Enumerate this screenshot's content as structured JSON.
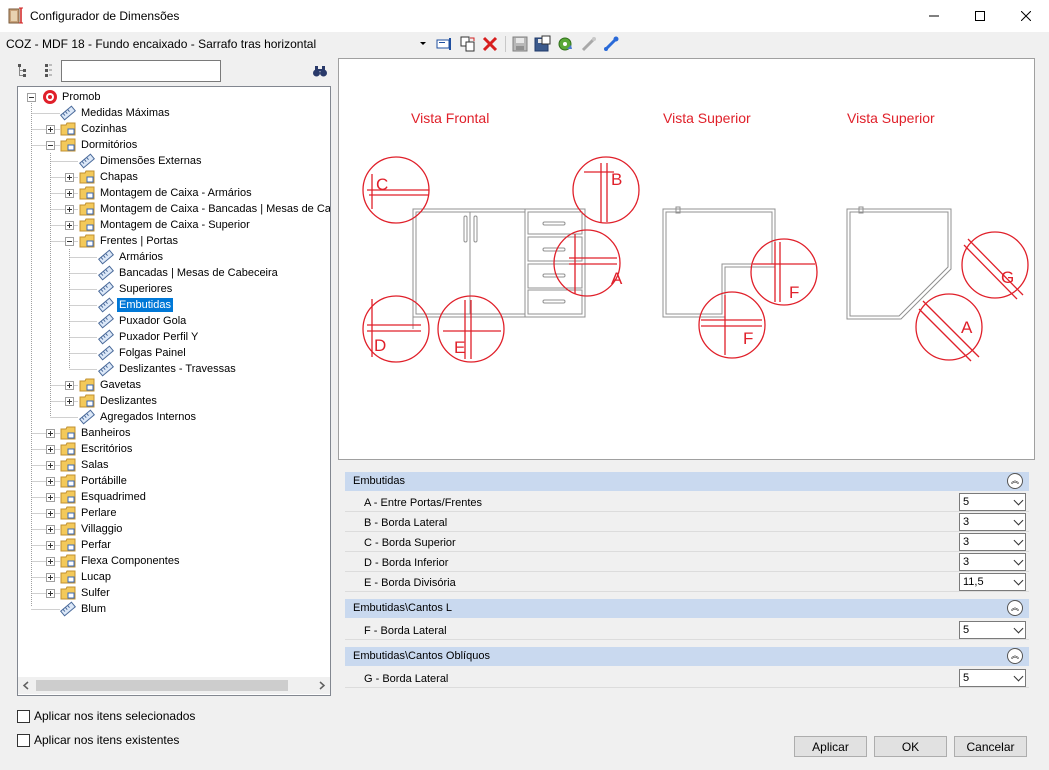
{
  "window": {
    "title": "Configurador de Dimensões",
    "minimize_label": "─",
    "maximize_label": "☐",
    "close_label": "✕"
  },
  "toolbar": {
    "config_value": "COZ - MDF 18 - Fundo encaixado - Sarrafo tras horizontal",
    "icons": [
      "form-icon",
      "copy-icon",
      "delete-icon",
      "save-icon",
      "save-as-icon",
      "settings-icon",
      "link-icon",
      "link-blue-icon"
    ]
  },
  "tree": {
    "items": [
      {
        "label": "Promob"
      },
      {
        "label": "Medidas Máximas"
      },
      {
        "label": "Cozinhas"
      },
      {
        "label": "Dormitórios"
      },
      {
        "label": "Dimensões Externas"
      },
      {
        "label": "Chapas"
      },
      {
        "label": "Montagem de Caixa - Armários"
      },
      {
        "label": "Montagem de Caixa - Bancadas | Mesas de Cabeceira"
      },
      {
        "label": "Montagem de Caixa - Superior"
      },
      {
        "label": "Frentes | Portas"
      },
      {
        "label": "Armários"
      },
      {
        "label": "Bancadas | Mesas de Cabeceira"
      },
      {
        "label": "Superiores"
      },
      {
        "label": "Embutidas"
      },
      {
        "label": "Puxador Gola"
      },
      {
        "label": "Puxador Perfil Y"
      },
      {
        "label": "Folgas Painel"
      },
      {
        "label": "Deslizantes - Travessas"
      },
      {
        "label": "Gavetas"
      },
      {
        "label": "Deslizantes"
      },
      {
        "label": "Agregados Internos"
      },
      {
        "label": "Banheiros"
      },
      {
        "label": "Escritórios"
      },
      {
        "label": "Salas"
      },
      {
        "label": "Portábille"
      },
      {
        "label": "Esquadrimed"
      },
      {
        "label": "Perlare"
      },
      {
        "label": "Villaggio"
      },
      {
        "label": "Perfar"
      },
      {
        "label": "Flexa Componentes"
      },
      {
        "label": "Lucap"
      },
      {
        "label": "Sulfer"
      },
      {
        "label": "Blum"
      }
    ]
  },
  "preview": {
    "titles": [
      "Vista Frontal",
      "Vista Superior",
      "Vista Superior"
    ],
    "markers": [
      "C",
      "B",
      "A",
      "D",
      "E",
      "F",
      "F",
      "G",
      "A"
    ]
  },
  "properties": {
    "groups": [
      {
        "title": "Embutidas",
        "rows": [
          {
            "label": "A - Entre Portas/Frentes",
            "value": "5"
          },
          {
            "label": "B - Borda Lateral",
            "value": "3"
          },
          {
            "label": "C - Borda Superior",
            "value": "3"
          },
          {
            "label": "D - Borda Inferior",
            "value": "3"
          },
          {
            "label": "E - Borda Divisória",
            "value": "11,5"
          }
        ]
      },
      {
        "title": "Embutidas\\Cantos L",
        "rows": [
          {
            "label": "F - Borda Lateral",
            "value": "5"
          }
        ]
      },
      {
        "title": "Embutidas\\Cantos Oblíquos",
        "rows": [
          {
            "label": "G - Borda Lateral",
            "value": "5"
          }
        ]
      }
    ],
    "collapse_glyph": "︽"
  },
  "options": {
    "apply_selected": "Aplicar nos itens selecionados",
    "apply_existing": "Aplicar nos itens existentes"
  },
  "buttons": {
    "apply": "Aplicar",
    "ok": "OK",
    "cancel": "Cancelar"
  },
  "colors": {
    "selection": "#0078d7",
    "category_header": "#c9d9ef",
    "diagram_red": "#e0202a"
  }
}
